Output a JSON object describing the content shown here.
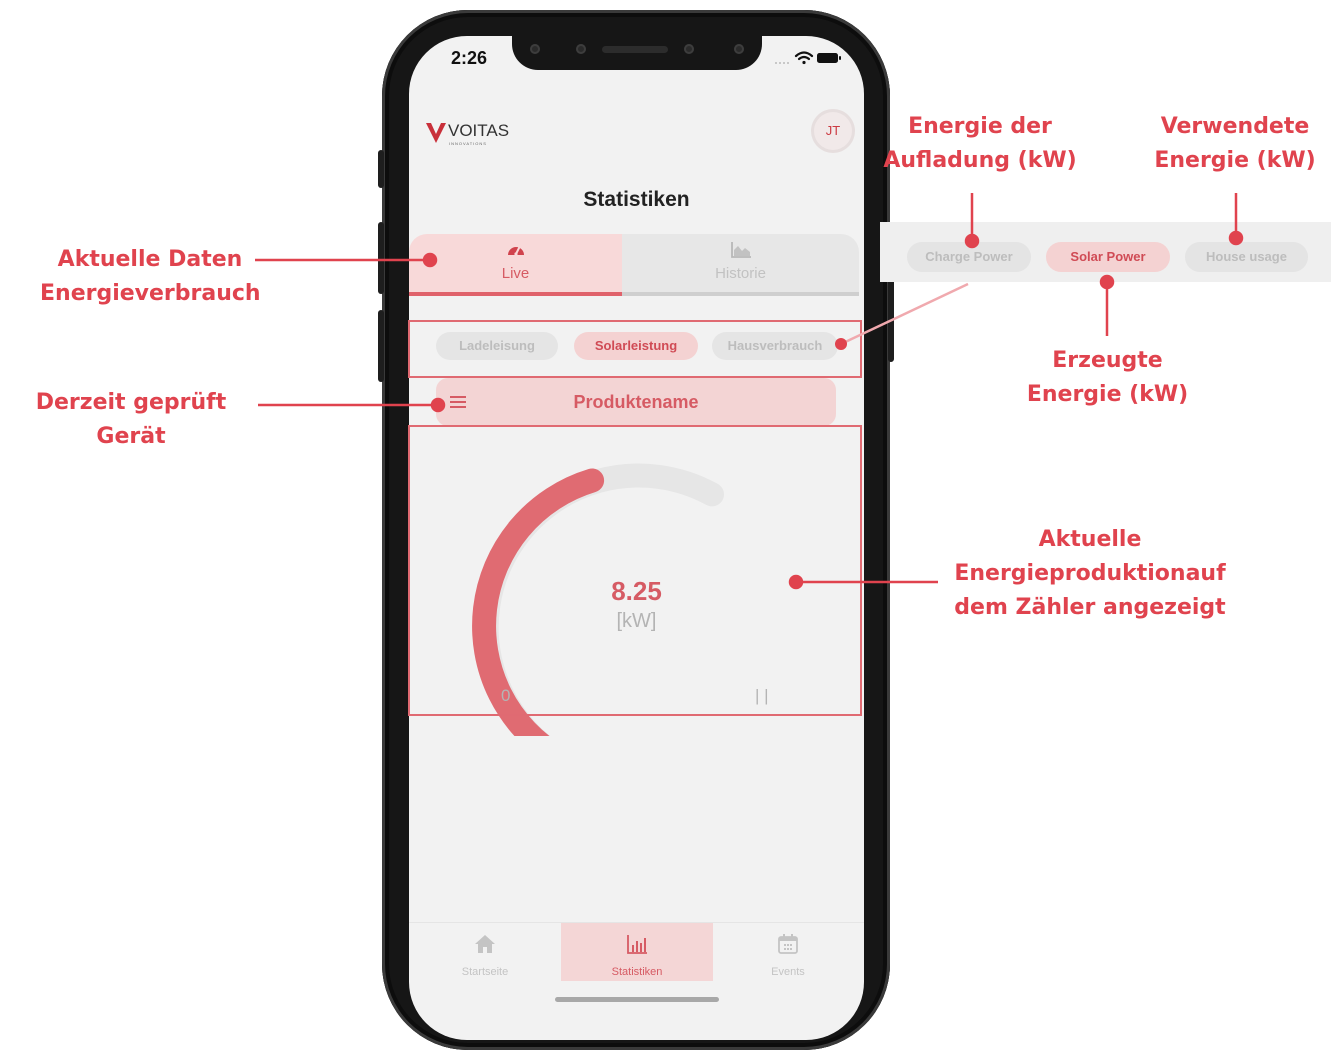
{
  "status_bar": {
    "time": "2:26"
  },
  "header": {
    "logo_text": "VOITAS",
    "logo_subtext": "INNOVATIONS",
    "avatar_initials": "JT"
  },
  "page_title": "Statistiken",
  "segments": {
    "live": "Live",
    "history": "Historie"
  },
  "filters": [
    {
      "label": "Ladeleisung",
      "active": false
    },
    {
      "label": "Solarleistung",
      "active": true
    },
    {
      "label": "Hausverbrauch",
      "active": false
    }
  ],
  "product": {
    "name": "Produktename"
  },
  "gauge": {
    "value": "8.25",
    "unit": "[kW]",
    "min_label": "0",
    "max_label": "| |",
    "fill_fraction": 0.74
  },
  "tabbar": [
    {
      "label": "Startseite",
      "icon": "home-icon",
      "active": false
    },
    {
      "label": "Statistiken",
      "icon": "bar-chart-icon",
      "active": true
    },
    {
      "label": "Events",
      "icon": "calendar-icon",
      "active": false
    }
  ],
  "legend_strip": [
    {
      "label": "Charge Power",
      "active": false
    },
    {
      "label": "Solar Power",
      "active": true
    },
    {
      "label": "House usage",
      "active": false
    }
  ],
  "annotations": {
    "live_data": [
      "Aktuelle Daten",
      "Energieverbrauch"
    ],
    "device": "Derzeit geprüft Gerät",
    "charge_energy": [
      "Energie der",
      "Aufladung (kW)"
    ],
    "used_energy": [
      "Verwendete",
      "Energie (kW)"
    ],
    "generated_energy": [
      "Erzeugte",
      "Energie (kW)"
    ],
    "current_production": [
      "Aktuelle",
      "Energieproduktionauf",
      "dem Zähler angezeigt"
    ]
  },
  "colors": {
    "accent": "#e0434e",
    "pink": "#f4d2d2",
    "gauge_fill": "#e06b72",
    "gauge_track": "#e6e6e6"
  }
}
